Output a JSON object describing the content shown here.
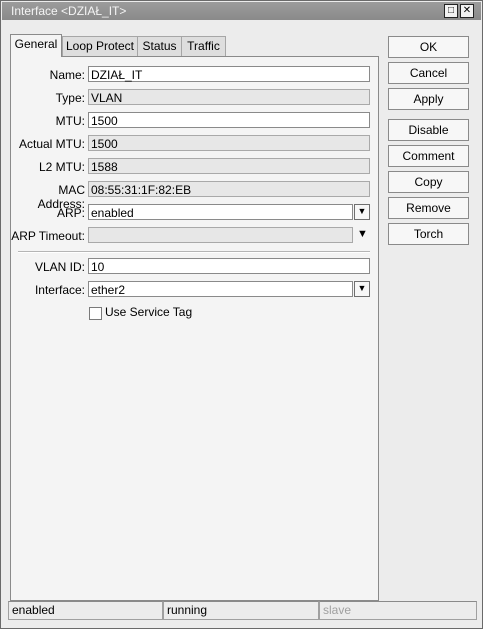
{
  "window": {
    "title": "Interface <DZIAŁ_IT>",
    "maximize_icon": "maximize-icon",
    "close_icon": "close-icon"
  },
  "tabs": [
    {
      "label": "General",
      "active": true
    },
    {
      "label": "Loop Protect"
    },
    {
      "label": "Status"
    },
    {
      "label": "Traffic"
    }
  ],
  "general": {
    "name": {
      "label": "Name:",
      "value": "DZIAŁ_IT"
    },
    "type": {
      "label": "Type:",
      "value": "VLAN"
    },
    "mtu": {
      "label": "MTU:",
      "value": "1500"
    },
    "actual_mtu": {
      "label": "Actual MTU:",
      "value": "1500"
    },
    "l2_mtu": {
      "label": "L2 MTU:",
      "value": "1588"
    },
    "mac": {
      "label": "MAC Address:",
      "value": "08:55:31:1F:82:EB"
    },
    "arp": {
      "label": "ARP:",
      "value": "enabled"
    },
    "arp_timeout": {
      "label": "ARP Timeout:",
      "value": ""
    },
    "vlan_id": {
      "label": "VLAN ID:",
      "value": "10"
    },
    "interface": {
      "label": "Interface:",
      "value": "ether2"
    },
    "service_tag": {
      "label": "Use Service Tag",
      "checked": false
    }
  },
  "buttons": {
    "ok": "OK",
    "cancel": "Cancel",
    "apply": "Apply",
    "disable": "Disable",
    "comment": "Comment",
    "copy": "Copy",
    "remove": "Remove",
    "torch": "Torch"
  },
  "status": {
    "state": "enabled",
    "running": "running",
    "slave": "slave"
  }
}
